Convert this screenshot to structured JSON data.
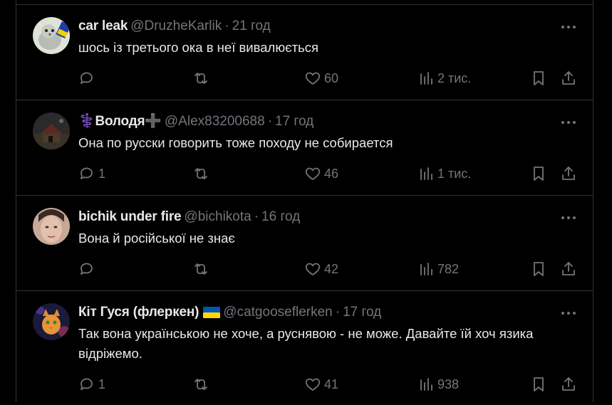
{
  "posts": [
    {
      "name": "car leak",
      "handle": "@DruzheKarlik",
      "time": "21 год",
      "text": "шось із третього ока в неї вивалюється",
      "stats": {
        "replies": "",
        "reposts": "",
        "likes": "60",
        "views": "2 тис."
      },
      "avatar": "pigeon-avatar"
    },
    {
      "name": "⚕️Володя➕",
      "handle": "@Alex83200688",
      "time": "17 год",
      "text": "Она по русски говорить тоже походу не собирается",
      "stats": {
        "replies": "1",
        "reposts": "",
        "likes": "46",
        "views": "1 тис."
      },
      "avatar": "house-avatar"
    },
    {
      "name": "bichik under fire",
      "handle": "@bichikota",
      "time": "16 год",
      "text": "Вона й російської не знає",
      "stats": {
        "replies": "",
        "reposts": "",
        "likes": "42",
        "views": "782"
      },
      "avatar": "woman-avatar"
    },
    {
      "name": "Кіт Гуся (флеркен)",
      "handle": "@catgooseflerken",
      "time": "17 год",
      "text": "Так вона українською не хоче, а руснявою - не може. Давайте їй хоч язика відріжемо.",
      "stats": {
        "replies": "1",
        "reposts": "",
        "likes": "41",
        "views": "938"
      },
      "avatar": "cat-avatar",
      "badge": "ukraine-flag"
    }
  ],
  "colors": {
    "background": "#000000",
    "text": "#e7e9ea",
    "muted": "#71767b",
    "divider": "#2f3336",
    "flag_blue": "#0057b7",
    "flag_yellow": "#ffd700"
  }
}
